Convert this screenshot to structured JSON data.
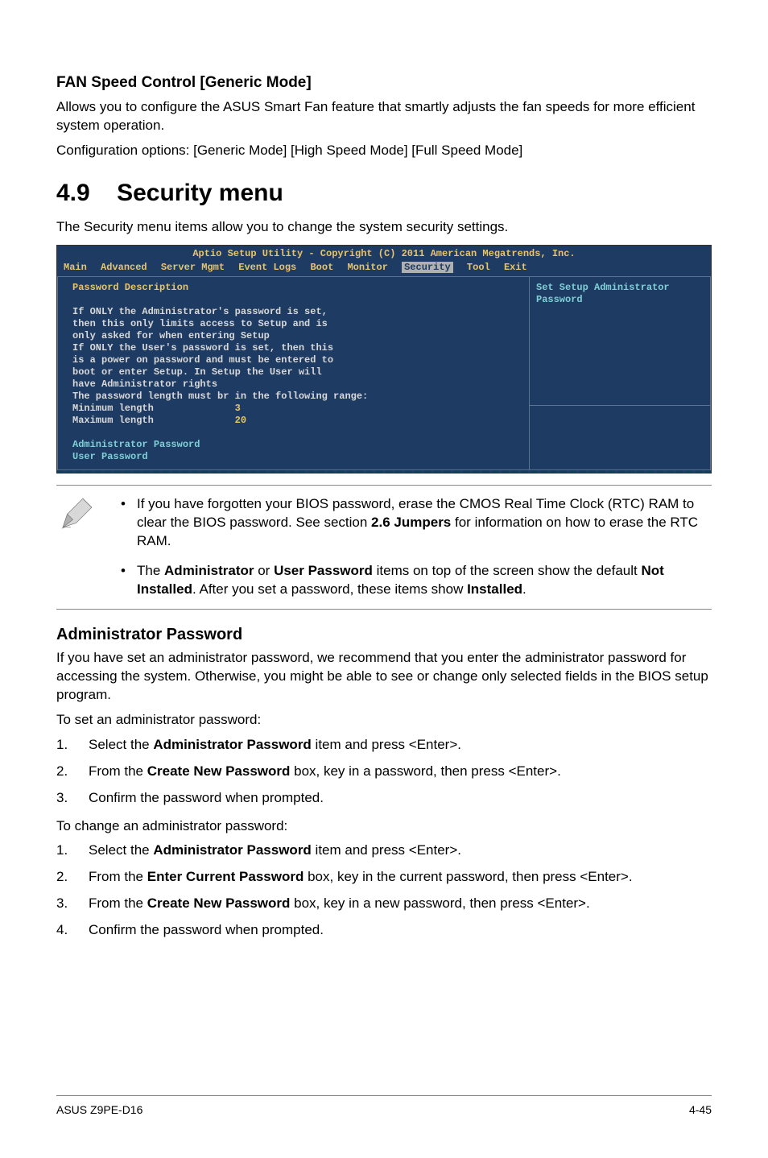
{
  "fan_section": {
    "heading": "FAN Speed Control [Generic Mode]",
    "para1": "Allows you to configure the ASUS Smart Fan feature that smartly adjusts the fan speeds for more efficient system operation.",
    "para2": "Configuration options: [Generic Mode] [High Speed Mode] [Full Speed Mode]"
  },
  "security_section": {
    "number": "4.9",
    "title": "Security menu",
    "intro": "The Security menu items allow you to change the system security settings."
  },
  "bios": {
    "title": "Aptio Setup Utility - Copyright (C) 2011 American Megatrends, Inc.",
    "tabs": [
      "Main",
      "Advanced",
      "Server Mgmt",
      "Event Logs",
      "Boot",
      "Monitor",
      "Security",
      "Tool",
      "Exit"
    ],
    "active_tab": "Security",
    "left": {
      "pw_desc_label": "Password Description",
      "body_lines": [
        "If ONLY the Administrator's password is set,",
        "then this only limits access to Setup and is",
        "only asked for when entering Setup",
        "If ONLY the User's password is set, then this",
        "is a power on password and must be entered to",
        "boot or enter Setup. In Setup the User will",
        "have Administrator rights",
        "The password length must br in the following range:"
      ],
      "min_label": "Minimum length",
      "min_val": "3",
      "max_label": "Maximum length",
      "max_val": "20",
      "admin_pw_item": "Administrator Password",
      "user_pw_item": "User Password"
    },
    "right_help": "Set Setup Administrator Password"
  },
  "notes": {
    "n1_pre": "If you have forgotten your BIOS password, erase the CMOS Real Time Clock (RTC) RAM to clear the BIOS password. See section ",
    "n1_bold": "2.6 Jumpers",
    "n1_post": " for information on how to erase the RTC RAM.",
    "n2_pre": "The ",
    "n2_b1": "Administrator",
    "n2_mid1": " or ",
    "n2_b2": "User Password",
    "n2_mid2": " items on top of the screen show the default ",
    "n2_b3": "Not Installed",
    "n2_mid3": ". After you set a password, these items show ",
    "n2_b4": "Installed",
    "n2_post": "."
  },
  "admin_pw": {
    "heading": "Administrator Password",
    "para": "If you have set an administrator password, we recommend that you enter the administrator password for accessing the system. Otherwise, you might be able to see or change only selected fields in the BIOS setup program.",
    "set_intro": "To set an administrator password:",
    "set_steps": {
      "s1_pre": "Select the ",
      "s1_b": "Administrator Password",
      "s1_post": " item and press <Enter>.",
      "s2_pre": "From the ",
      "s2_b": "Create New Password",
      "s2_post": " box, key in a password, then press <Enter>.",
      "s3": "Confirm the password when prompted."
    },
    "change_intro": "To change an administrator password:",
    "change_steps": {
      "s1_pre": "Select the ",
      "s1_b": "Administrator Password",
      "s1_post": " item and press <Enter>.",
      "s2_pre": "From the ",
      "s2_b": "Enter Current Password",
      "s2_post": " box, key in the current password, then press <Enter>.",
      "s3_pre": "From the ",
      "s3_b": "Create New Password",
      "s3_post": " box, key in a new password, then press <Enter>.",
      "s4": "Confirm the password when prompted."
    }
  },
  "footer": {
    "left": "ASUS Z9PE-D16",
    "right": "4-45"
  }
}
